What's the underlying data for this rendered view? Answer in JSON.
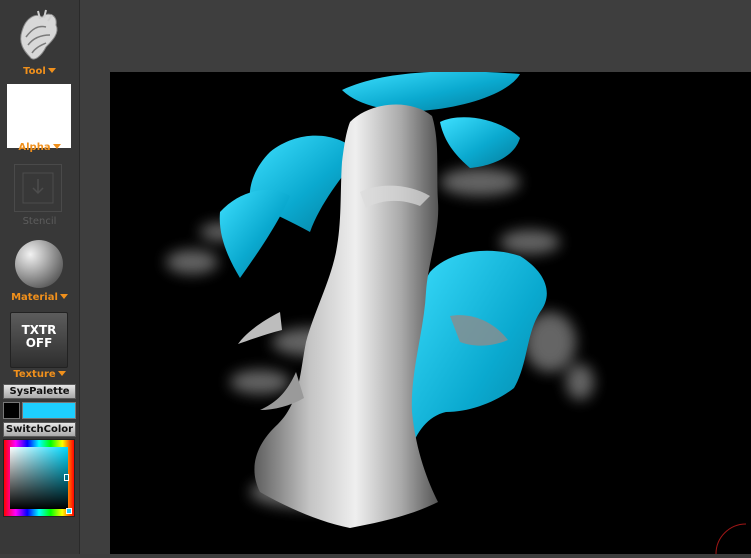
{
  "left_tray": {
    "tool": {
      "label": "Tool",
      "icon": "brush-tool-icon"
    },
    "alpha": {
      "label": "Alpha",
      "swatch_color": "#ffffff"
    },
    "stencil": {
      "label": "Stencil"
    },
    "material": {
      "label": "Material",
      "icon": "sphere-material-icon"
    },
    "texture": {
      "label": "Texture",
      "button_line1": "TXTR",
      "button_line2": "OFF"
    },
    "sys_palette_label": "SysPalette",
    "switch_color_label": "SwitchColor",
    "colors": {
      "main": "#1ecfff",
      "secondary": "#000000"
    }
  },
  "canvas": {
    "background": "#000000",
    "accent_color": "#1ecfff"
  }
}
